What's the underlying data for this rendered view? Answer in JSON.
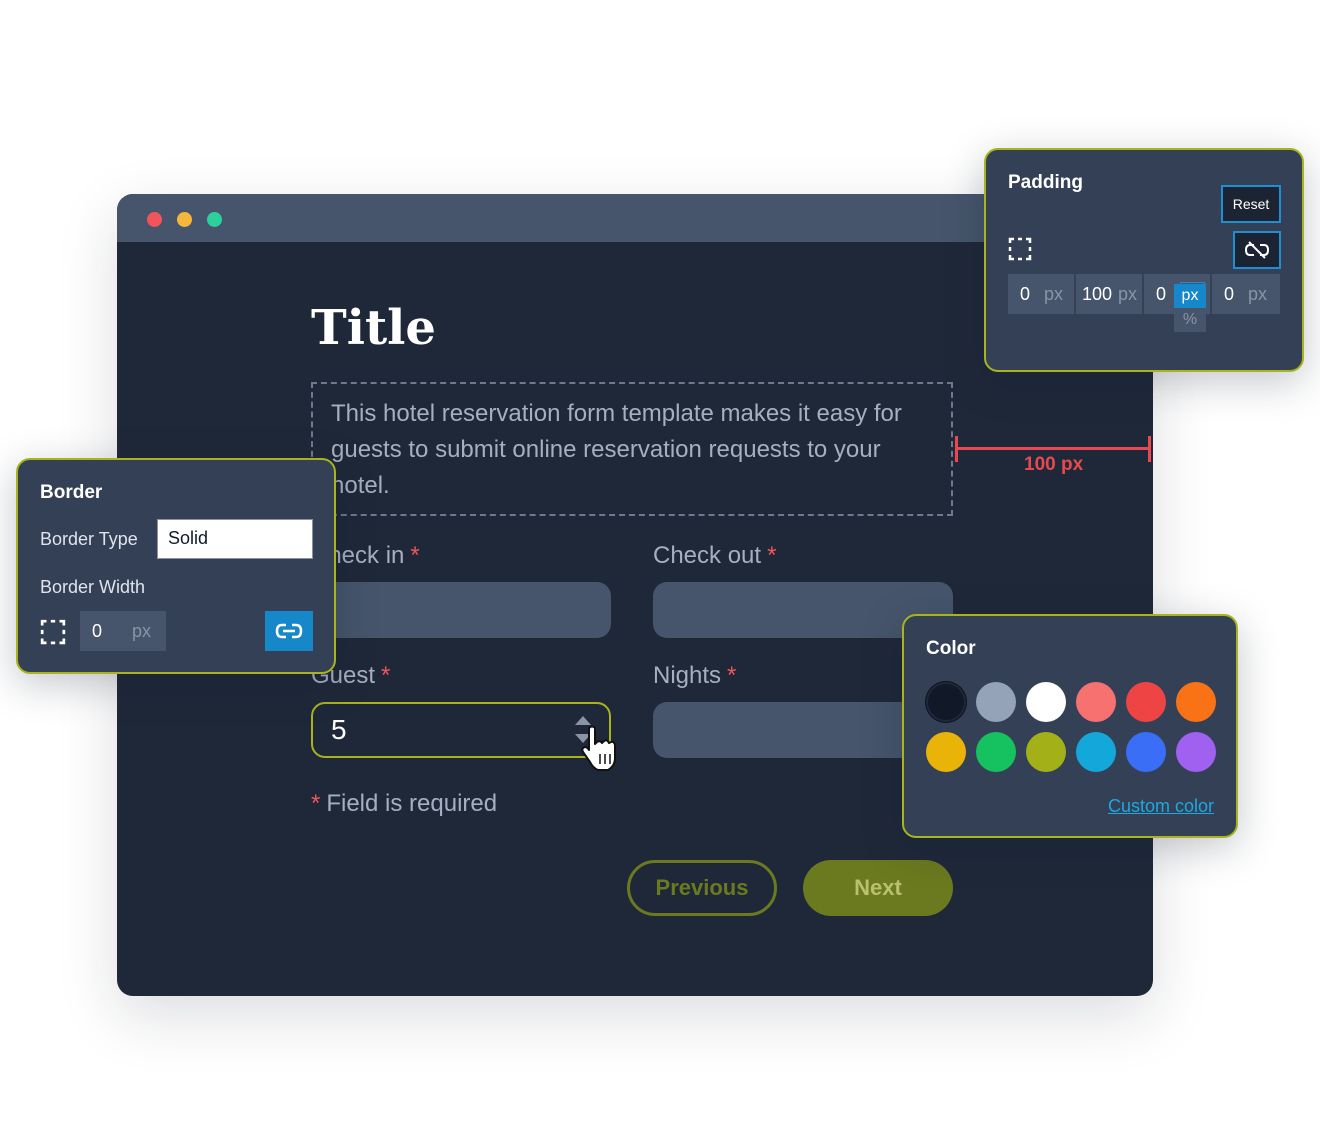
{
  "form": {
    "title": "Title",
    "description": "This hotel reservation form template makes it easy for guests to submit online reservation requests to your hotel.",
    "fields": {
      "check_in": {
        "label": "Check in",
        "required_mark": "*"
      },
      "check_out": {
        "label": "Check out",
        "required_mark": "*"
      },
      "guest": {
        "label": "Guest",
        "required_mark": "*",
        "value": "5"
      },
      "nights": {
        "label": "Nights",
        "required_mark": "*"
      }
    },
    "required_note": {
      "mark": "*",
      "text": "Field is required"
    },
    "buttons": {
      "previous": "Previous",
      "next": "Next"
    }
  },
  "measurement": {
    "label": "100 px"
  },
  "padding_panel": {
    "title": "Padding",
    "reset_label": "Reset",
    "fields": [
      {
        "value": "0",
        "unit": "px"
      },
      {
        "value": "100",
        "unit": "px"
      },
      {
        "value": "0",
        "unit": "px"
      },
      {
        "value": "0",
        "unit": "px"
      }
    ],
    "unit_options": [
      "px",
      "%"
    ],
    "selected_unit": "px"
  },
  "border_panel": {
    "title": "Border",
    "border_type_label": "Border Type",
    "border_type_value": "Solid",
    "border_width_label": "Border Width",
    "width_value": "0",
    "width_unit": "px"
  },
  "color_panel": {
    "title": "Color",
    "swatches": [
      "#111827",
      "#94a3b8",
      "#ffffff",
      "#f87171",
      "#ef4444",
      "#f97316",
      "#eab308",
      "#16c25f",
      "#a3b018",
      "#13a8d9",
      "#3b6ef6",
      "#a060f0"
    ],
    "custom_color_label": "Custom color"
  },
  "colors": {
    "accent_olive": "#a9b31a",
    "button_olive": "#6b7a1e",
    "required_red": "#f2545b",
    "link_blue": "#1ea8e0",
    "window_dots": [
      "#f2545b",
      "#f5b73b",
      "#2bd09a"
    ]
  }
}
